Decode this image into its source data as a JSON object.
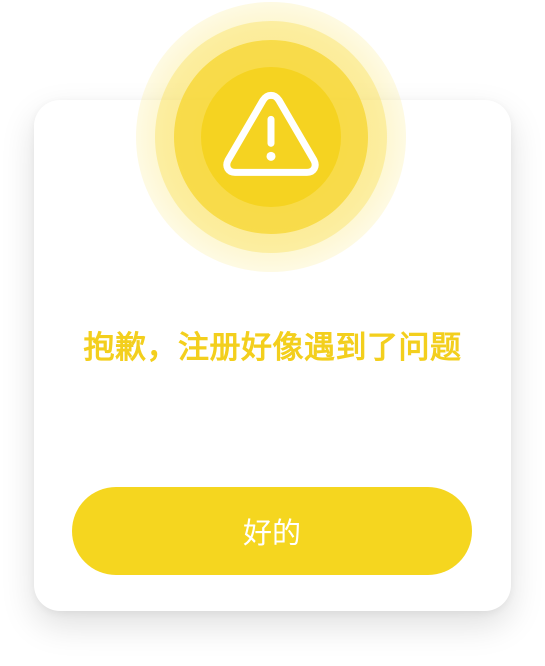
{
  "dialog": {
    "icon": "warning-icon",
    "message": "抱歉，注册好像遇到了问题",
    "confirm_label": "好的"
  },
  "colors": {
    "accent": "#f5d61f",
    "message_text": "#f3cf1d",
    "button_text": "#ffffff",
    "background": "#ffffff"
  }
}
